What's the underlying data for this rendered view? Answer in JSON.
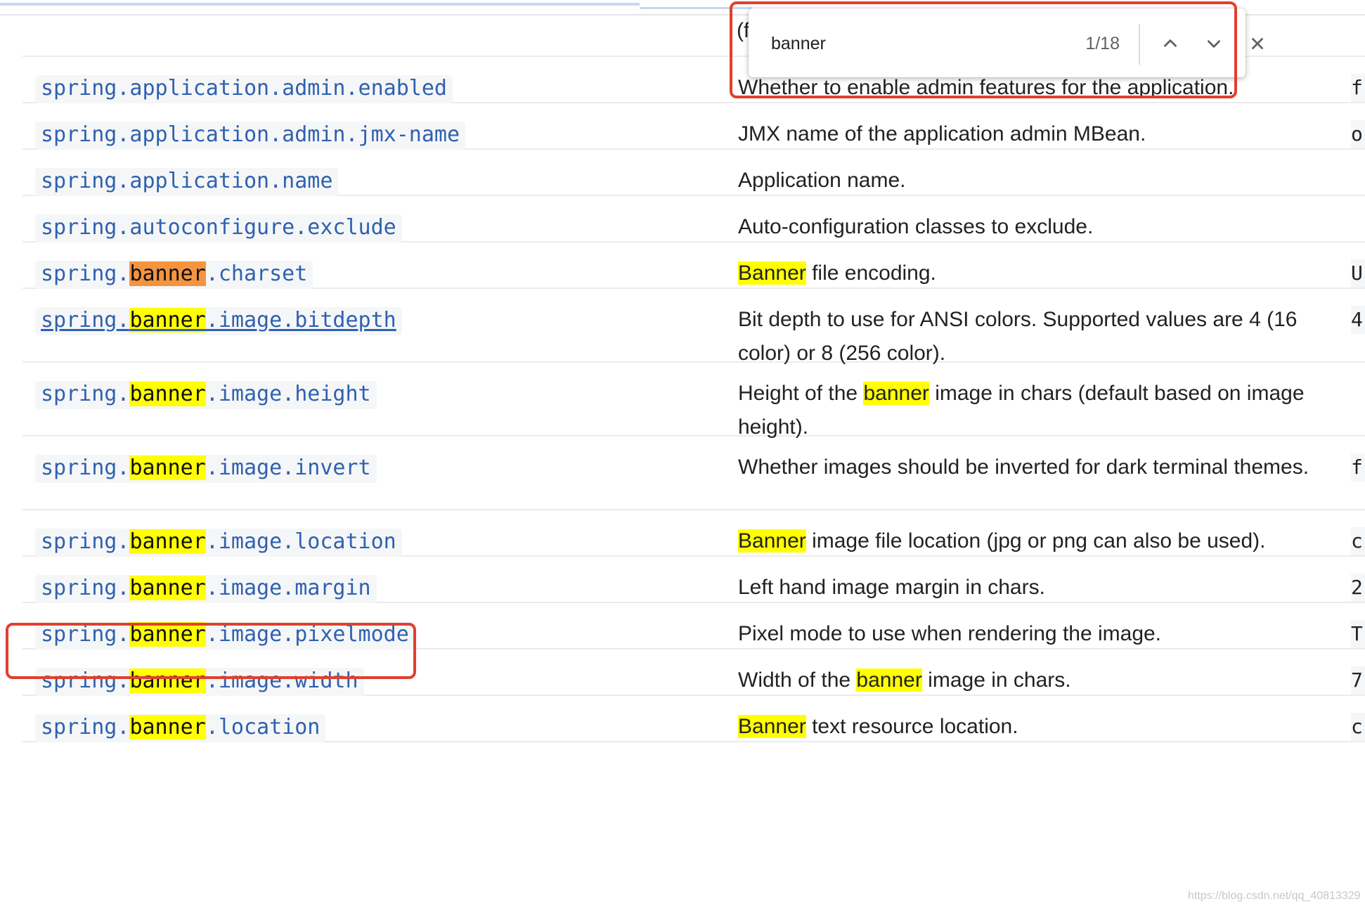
{
  "find": {
    "query": "banner",
    "count": "1/18",
    "prev_label": "previous match",
    "next_label": "next match",
    "close_label": "close find bar"
  },
  "header_partial": "(f",
  "rows": [
    {
      "key_parts": [
        {
          "t": "spring.application.admin.enabled",
          "hl": ""
        }
      ],
      "link": false,
      "desc_parts": [
        {
          "t": "Whether to enable admin features for the application.",
          "hl": ""
        }
      ],
      "default": "f"
    },
    {
      "key_parts": [
        {
          "t": "spring.application.admin.jmx-name",
          "hl": ""
        }
      ],
      "link": false,
      "desc_parts": [
        {
          "t": "JMX name of the application admin MBean.",
          "hl": ""
        }
      ],
      "default": "o"
    },
    {
      "key_parts": [
        {
          "t": "spring.application.name",
          "hl": ""
        }
      ],
      "link": false,
      "desc_parts": [
        {
          "t": "Application name.",
          "hl": ""
        }
      ],
      "default": ""
    },
    {
      "key_parts": [
        {
          "t": "spring.autoconfigure.exclude",
          "hl": ""
        }
      ],
      "link": false,
      "desc_parts": [
        {
          "t": "Auto-configuration classes to exclude.",
          "hl": ""
        }
      ],
      "default": ""
    },
    {
      "key_parts": [
        {
          "t": "spring.",
          "hl": ""
        },
        {
          "t": "banner",
          "hl": "current"
        },
        {
          "t": ".charset",
          "hl": ""
        }
      ],
      "link": false,
      "desc_parts": [
        {
          "t": "Banner",
          "hl": "match"
        },
        {
          "t": " file encoding.",
          "hl": ""
        }
      ],
      "default": "U"
    },
    {
      "key_parts": [
        {
          "t": "spring.",
          "hl": ""
        },
        {
          "t": "banner",
          "hl": "match"
        },
        {
          "t": ".image.bitdepth",
          "hl": ""
        }
      ],
      "link": true,
      "desc_parts": [
        {
          "t": "Bit depth to use for ANSI colors. Supported values are 4 (16 color) or 8 (256 color).",
          "hl": ""
        }
      ],
      "default": "4"
    },
    {
      "key_parts": [
        {
          "t": "spring.",
          "hl": ""
        },
        {
          "t": "banner",
          "hl": "match"
        },
        {
          "t": ".image.height",
          "hl": ""
        }
      ],
      "link": false,
      "desc_parts": [
        {
          "t": "Height of the ",
          "hl": ""
        },
        {
          "t": "banner",
          "hl": "match"
        },
        {
          "t": " image in chars (default based on image height).",
          "hl": ""
        }
      ],
      "default": ""
    },
    {
      "key_parts": [
        {
          "t": "spring.",
          "hl": ""
        },
        {
          "t": "banner",
          "hl": "match"
        },
        {
          "t": ".image.invert",
          "hl": ""
        }
      ],
      "link": false,
      "desc_parts": [
        {
          "t": "Whether images should be inverted for dark terminal themes.",
          "hl": ""
        }
      ],
      "default": "f"
    },
    {
      "key_parts": [
        {
          "t": "spring.",
          "hl": ""
        },
        {
          "t": "banner",
          "hl": "match"
        },
        {
          "t": ".image.location",
          "hl": ""
        }
      ],
      "link": false,
      "desc_parts": [
        {
          "t": "Banner",
          "hl": "match"
        },
        {
          "t": " image file location (jpg or png can also be used).",
          "hl": ""
        }
      ],
      "default": "c"
    },
    {
      "key_parts": [
        {
          "t": "spring.",
          "hl": ""
        },
        {
          "t": "banner",
          "hl": "match"
        },
        {
          "t": ".image.margin",
          "hl": ""
        }
      ],
      "link": false,
      "desc_parts": [
        {
          "t": "Left hand image margin in chars.",
          "hl": ""
        }
      ],
      "default": "2"
    },
    {
      "key_parts": [
        {
          "t": "spring.",
          "hl": ""
        },
        {
          "t": "banner",
          "hl": "match"
        },
        {
          "t": ".image.pixelmode",
          "hl": ""
        }
      ],
      "link": false,
      "desc_parts": [
        {
          "t": "Pixel mode to use when rendering the image.",
          "hl": ""
        }
      ],
      "default": "T"
    },
    {
      "key_parts": [
        {
          "t": "spring.",
          "hl": ""
        },
        {
          "t": "banner",
          "hl": "match"
        },
        {
          "t": ".image.width",
          "hl": ""
        }
      ],
      "link": false,
      "desc_parts": [
        {
          "t": "Width of the ",
          "hl": ""
        },
        {
          "t": "banner",
          "hl": "match"
        },
        {
          "t": " image in chars.",
          "hl": ""
        }
      ],
      "default": "7"
    },
    {
      "key_parts": [
        {
          "t": "spring.",
          "hl": ""
        },
        {
          "t": "banner",
          "hl": "match"
        },
        {
          "t": ".location",
          "hl": ""
        }
      ],
      "link": false,
      "desc_parts": [
        {
          "t": "Banner",
          "hl": "match"
        },
        {
          "t": " text resource location.",
          "hl": ""
        }
      ],
      "default": "c"
    }
  ],
  "watermark": "https://blog.csdn.net/qq_40813329",
  "colors": {
    "key_text": "#2f61b0",
    "match_highlight": "#ffff00",
    "current_match_highlight": "#f49440",
    "annotation": "#e0402e"
  },
  "icons": {
    "prev": "chevron-up-icon",
    "next": "chevron-down-icon",
    "close": "close-icon"
  }
}
